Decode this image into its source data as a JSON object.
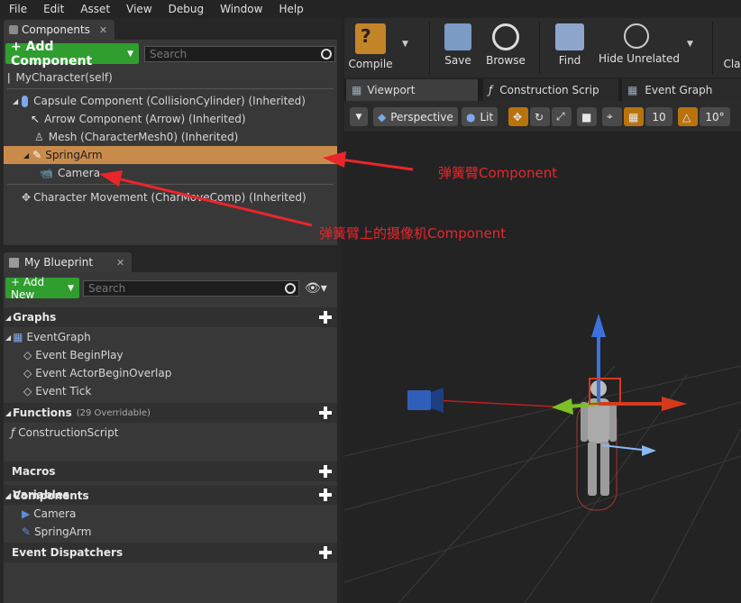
{
  "menu": [
    "File",
    "Edit",
    "Asset",
    "View",
    "Debug",
    "Window",
    "Help"
  ],
  "components_panel": {
    "tab_label": "Components",
    "add_button": "+ Add Component",
    "search_placeholder": "Search",
    "root": "MyCharacter(self)",
    "items": [
      {
        "label": "Capsule Component (CollisionCylinder) (Inherited)",
        "icon": "capsule-icon"
      },
      {
        "label": "Arrow Component (Arrow) (Inherited)",
        "icon": "arrow-icon"
      },
      {
        "label": "Mesh (CharacterMesh0) (Inherited)",
        "icon": "mesh-icon"
      },
      {
        "label": "SpringArm",
        "icon": "spring-arm-icon",
        "selected": true
      },
      {
        "label": "Camera",
        "icon": "camera-icon"
      },
      {
        "label": "Character Movement (CharMoveComp) (Inherited)",
        "icon": "movement-icon"
      }
    ]
  },
  "blueprint_panel": {
    "tab_label": "My Blueprint",
    "add_button": "+ Add New",
    "search_placeholder": "Search",
    "graphs_header": "Graphs",
    "event_graph": "EventGraph",
    "events": [
      "Event BeginPlay",
      "Event ActorBeginOverlap",
      "Event Tick"
    ],
    "functions_header": "Functions",
    "functions_count": "(29 Overridable)",
    "function_items": [
      "ConstructionScript"
    ],
    "macros_header": "Macros",
    "variables_header": "Variables",
    "components_header": "Components",
    "component_items": [
      "Camera",
      "SpringArm"
    ],
    "dispatchers_header": "Event Dispatchers"
  },
  "toolbar": {
    "compile": "Compile",
    "save": "Save",
    "browse": "Browse",
    "find": "Find",
    "hide_unrelated": "Hide Unrelated",
    "class_truncated": "Cla"
  },
  "editor_tabs": [
    "Viewport",
    "Construction Scrip",
    "Event Graph"
  ],
  "viewport_toolbar": {
    "perspective": "Perspective",
    "lit": "Lit",
    "grid_snap": "10",
    "rot_snap": "10°"
  },
  "annotations": {
    "spring_arm": "弹簧臂Component",
    "camera": "弹簧臂上的摄像机Component"
  },
  "colors": {
    "annotation_red": "#e8262b",
    "selected_row": "#c98b4c",
    "add_green": "#2f9e2f"
  }
}
